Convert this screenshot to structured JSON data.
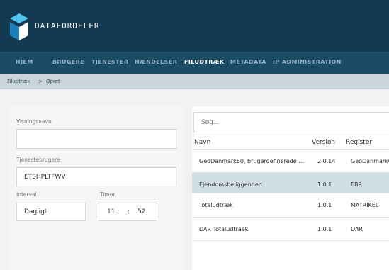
{
  "brand": {
    "name": "DATAFORDELER"
  },
  "nav": {
    "items": [
      {
        "label": "HJEM",
        "active": false
      },
      {
        "label": "BRUGERE",
        "active": false
      },
      {
        "label": "TJENESTER",
        "active": false
      },
      {
        "label": "HÆNDELSER",
        "active": false
      },
      {
        "label": "FILUDTRÆK",
        "active": true
      },
      {
        "label": "METADATA",
        "active": false
      },
      {
        "label": "IP ADMINISTRATION",
        "active": false
      }
    ]
  },
  "breadcrumb": {
    "parent": "Filudtræk",
    "separator": ">",
    "current": "Opret"
  },
  "form": {
    "display_name_label": "Visningsnavn",
    "display_name_value": "",
    "service_users_label": "Tjenestebrugere",
    "service_users_value": "ETSHPLTFWV",
    "interval_label": "Interval",
    "interval_value": "Dagligt",
    "hours_label": "Timer",
    "hours_value": "11",
    "minutes_value": "52",
    "time_separator": ":"
  },
  "search": {
    "placeholder": "Søg..."
  },
  "table": {
    "columns": [
      "Navn",
      "Version",
      "Register"
    ],
    "rows": [
      {
        "name": "GeoDanmark60, brugerdefinerede …",
        "version": "2.0.14",
        "register": "GeoDanmark60",
        "selected": false
      },
      {
        "name": "Ejendomsbeliggenhed",
        "version": "1.0.1",
        "register": "EBR",
        "selected": true
      },
      {
        "name": "Totaludtræk",
        "version": "1.0.1",
        "register": "MATRIKEL",
        "selected": false
      },
      {
        "name": "DAR Totaludtraek",
        "version": "1.0.1",
        "register": "DAR",
        "selected": false
      }
    ]
  },
  "colors": {
    "header": "#133a52",
    "nav": "#1b4c66",
    "breadcrumb_bar": "#c9d5db",
    "selected_row": "#cfdfe5",
    "logo_light": "#4fc3ee",
    "logo_dark": "#1e7fb8"
  }
}
